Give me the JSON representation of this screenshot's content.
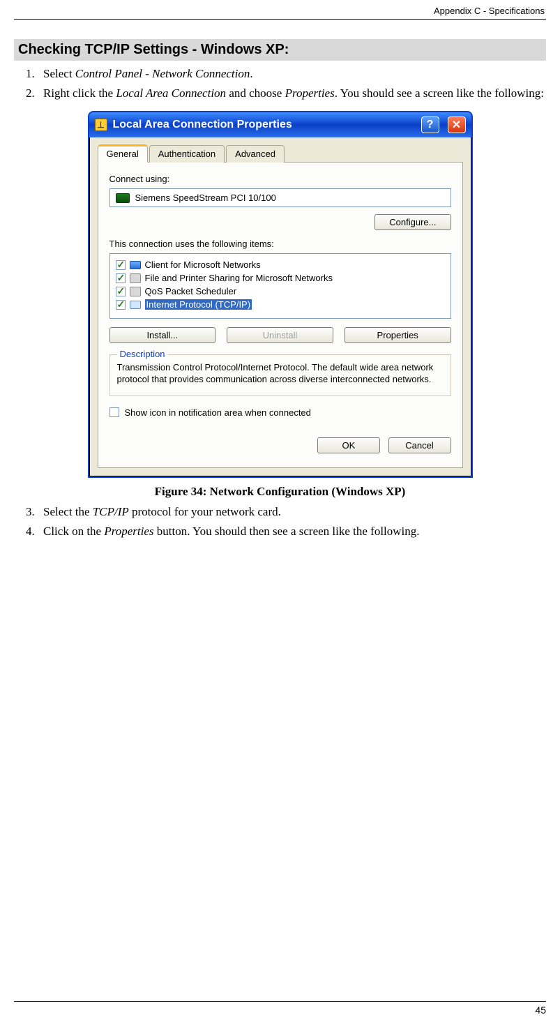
{
  "header": {
    "breadcrumb": "Appendix C - Specifications"
  },
  "section": {
    "heading": "Checking TCP/IP Settings - Windows XP:"
  },
  "steps": {
    "step1_pre": "Select ",
    "step1_italic": "Control Panel - Network Connection",
    "step1_post": ".",
    "step2_pre": "Right click the ",
    "step2_italic1": "Local Area Connection",
    "step2_mid": " and choose ",
    "step2_italic2": "Properties",
    "step2_post": ". You should see a screen like the following:",
    "step3_pre": "Select the ",
    "step3_italic": "TCP/IP",
    "step3_post": " protocol for your network card.",
    "step4_pre": "Click on the ",
    "step4_italic": "Properties",
    "step4_post": " button. You should then see a screen like the following."
  },
  "dialog": {
    "title": "Local Area Connection Properties",
    "tabs": {
      "general": "General",
      "authentication": "Authentication",
      "advanced": "Advanced"
    },
    "connect_label": "Connect using:",
    "adapter": "Siemens SpeedStream PCI 10/100",
    "configure_btn": "Configure...",
    "items_label": "This connection uses the following items:",
    "items": [
      {
        "label": "Client for Microsoft Networks"
      },
      {
        "label": "File and Printer Sharing for Microsoft Networks"
      },
      {
        "label": "QoS Packet Scheduler"
      },
      {
        "label": "Internet Protocol (TCP/IP)"
      }
    ],
    "install_btn": "Install...",
    "uninstall_btn": "Uninstall",
    "properties_btn": "Properties",
    "description_legend": "Description",
    "description_text": "Transmission Control Protocol/Internet Protocol. The default wide area network protocol that provides communication across diverse interconnected networks.",
    "show_icon_label": "Show icon in notification area when connected",
    "ok_btn": "OK",
    "cancel_btn": "Cancel"
  },
  "figure_caption": "Figure 34: Network Configuration (Windows XP)",
  "page_number": "45"
}
